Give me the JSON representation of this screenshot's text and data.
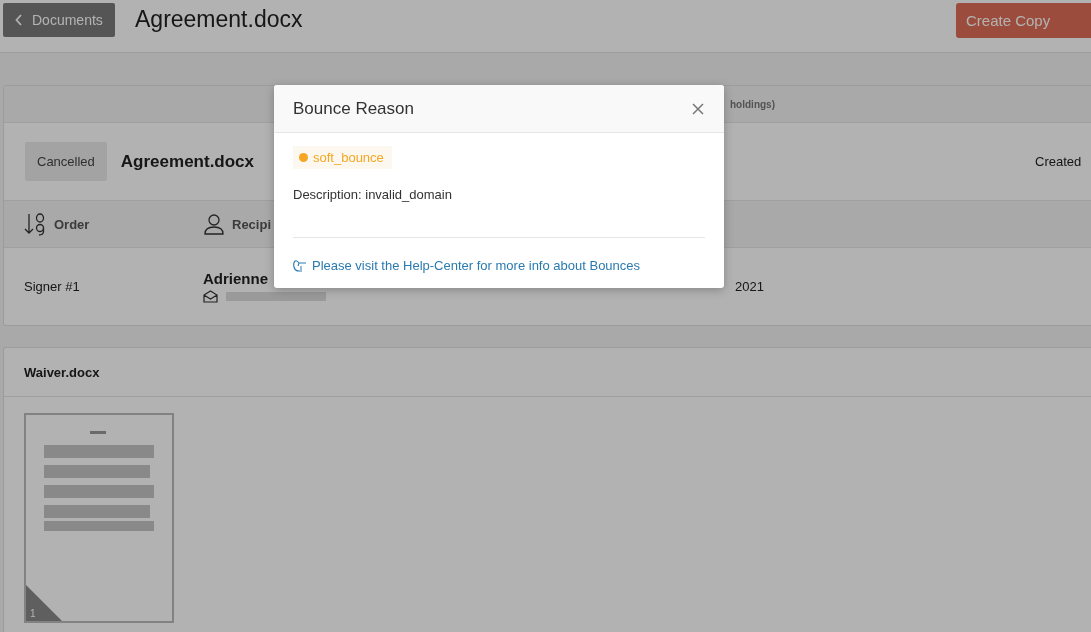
{
  "header": {
    "back_button": "Documents",
    "title": "Agreement.docx",
    "create_copy_button": "Create Copy"
  },
  "document_card": {
    "banner": "holdings)",
    "status": "Cancelled",
    "name": "Agreement.docx",
    "created": "Created",
    "columns": [
      {
        "label": "Order",
        "kind": "order"
      },
      {
        "label": "Recipi",
        "kind": "person"
      }
    ],
    "rows": [
      {
        "order": "Signer #1",
        "recipient": "Adrienne",
        "date": "2021"
      }
    ]
  },
  "waiver_card": {
    "name": "Waiver.docx",
    "pages": [
      {
        "number": "1",
        "kind": "picture"
      }
    ]
  },
  "modal": {
    "title": "Bounce Reason",
    "tag": {
      "label": "soft_bounce",
      "color": "#f5a623"
    },
    "description": "Description: invalid_domain",
    "help_link": "Please visit the Help-Center for more info about Bounces"
  }
}
